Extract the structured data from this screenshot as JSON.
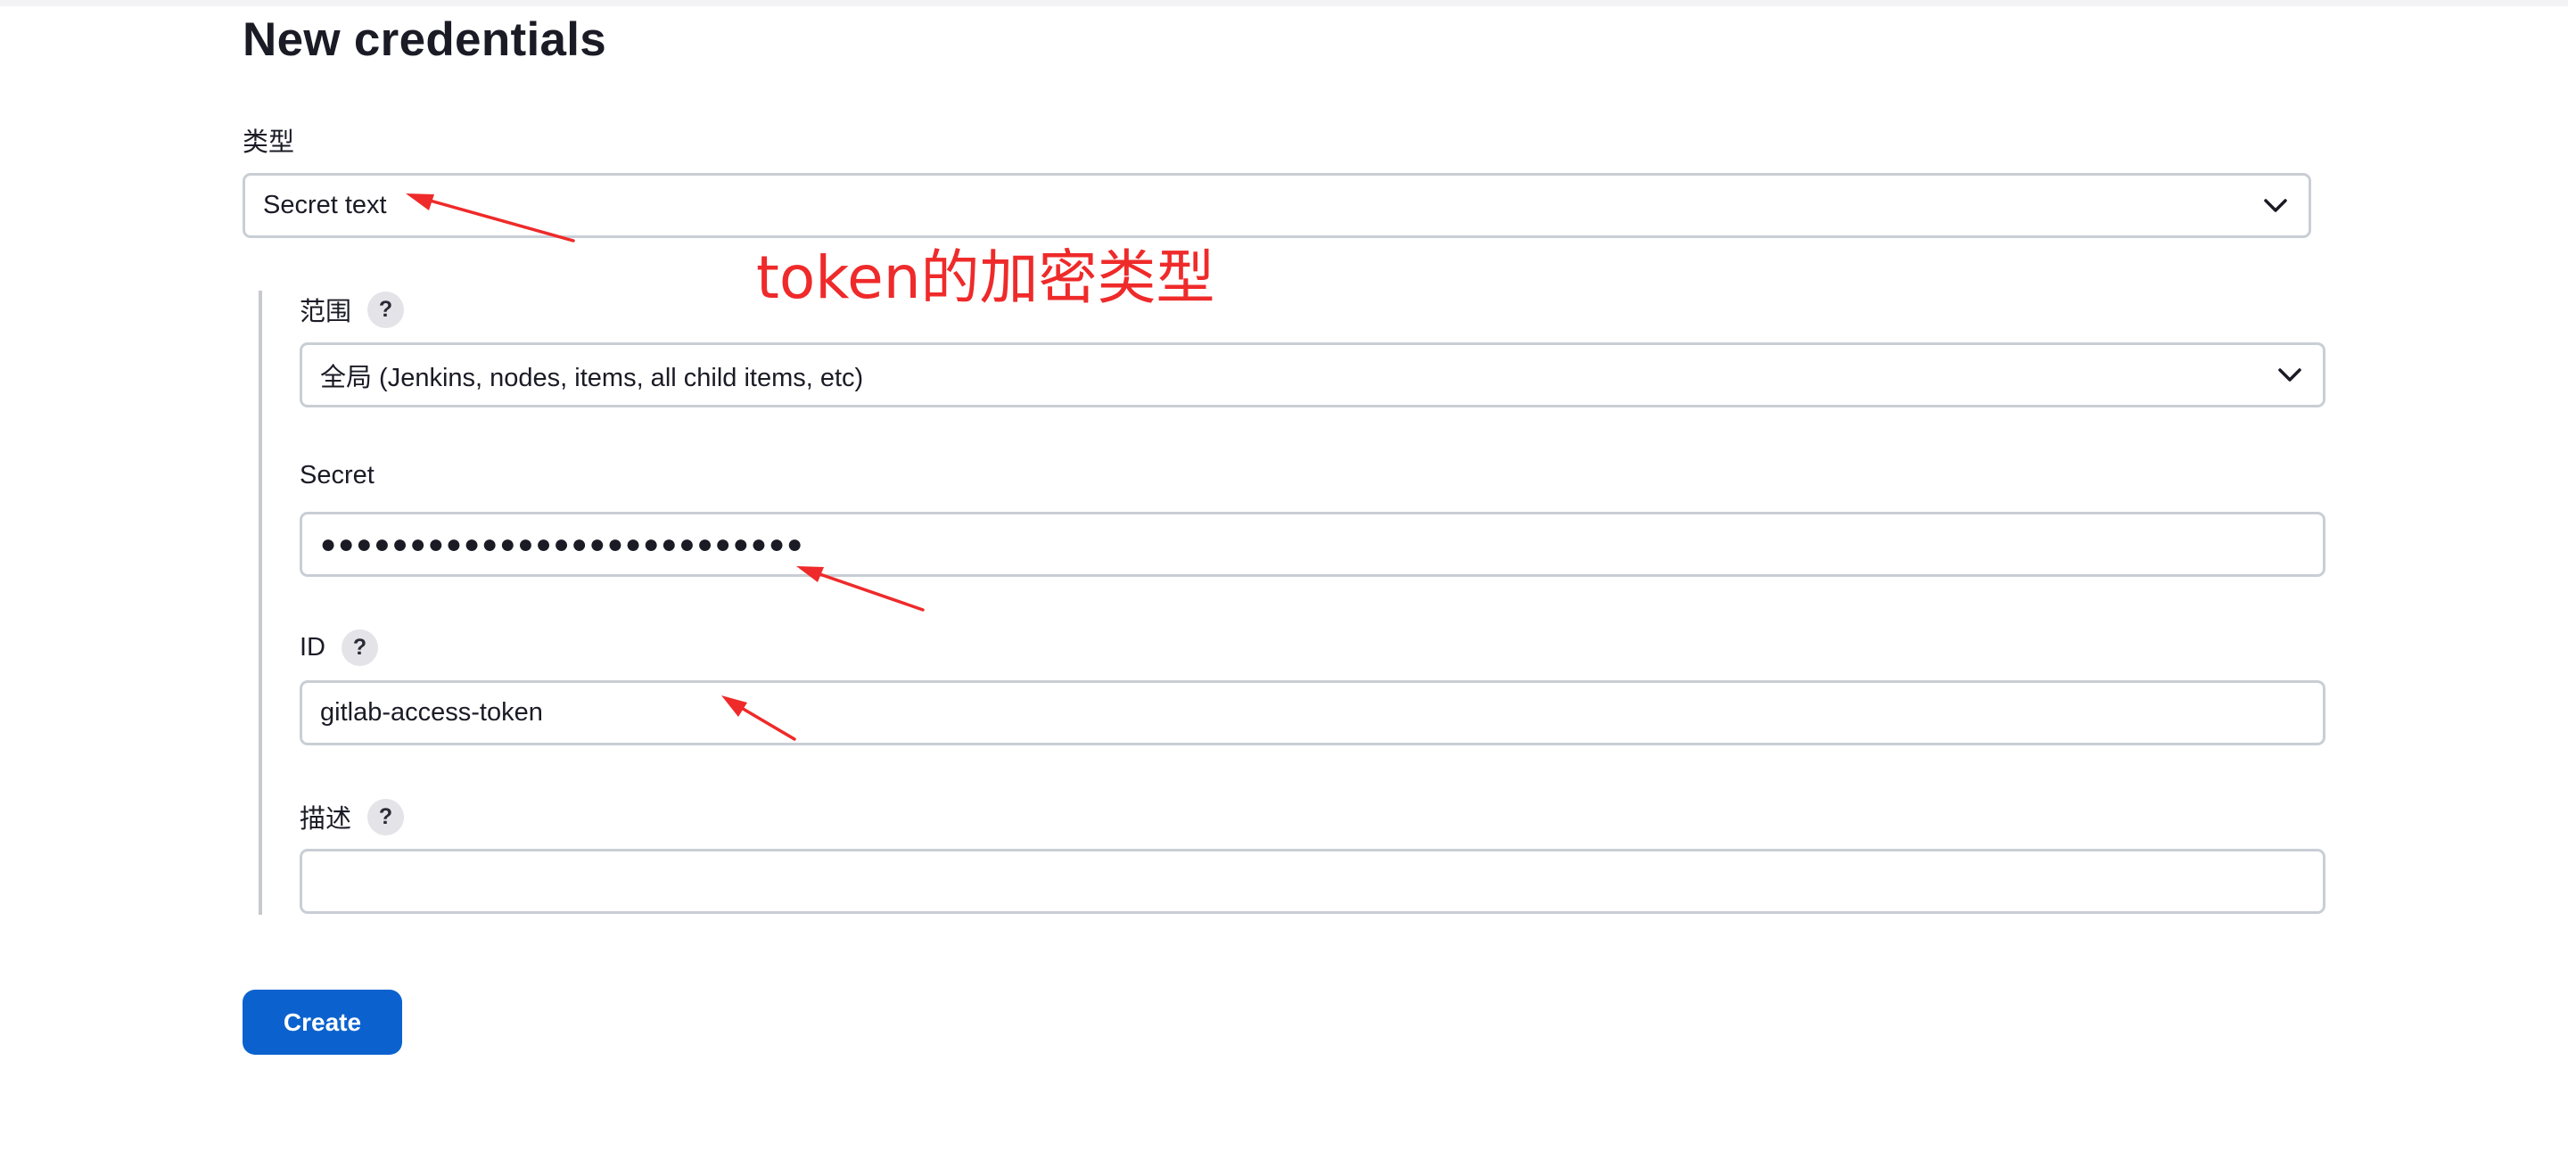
{
  "page": {
    "title": "New credentials"
  },
  "form": {
    "type": {
      "label": "类型",
      "value": "Secret text"
    },
    "scope": {
      "label": "范围",
      "help": "?",
      "value": "全局 (Jenkins, nodes, items, all child items, etc)"
    },
    "secret": {
      "label": "Secret",
      "value_masked": "●●●●●●●●●●●●●●●●●●●●●●●●●●●"
    },
    "id": {
      "label": "ID",
      "help": "?",
      "value": "gitlab-access-token"
    },
    "description": {
      "label": "描述",
      "help": "?",
      "value": ""
    },
    "create_label": "Create"
  },
  "annotation": {
    "text": "token的加密类型",
    "color": "#ef2a2a"
  },
  "colors": {
    "accent": "#0b62cf",
    "border": "#c9ced5",
    "annotation": "#ef2a2a"
  },
  "icons": {
    "select_arrow": "chevron-down-icon",
    "help": "question-mark-icon"
  }
}
